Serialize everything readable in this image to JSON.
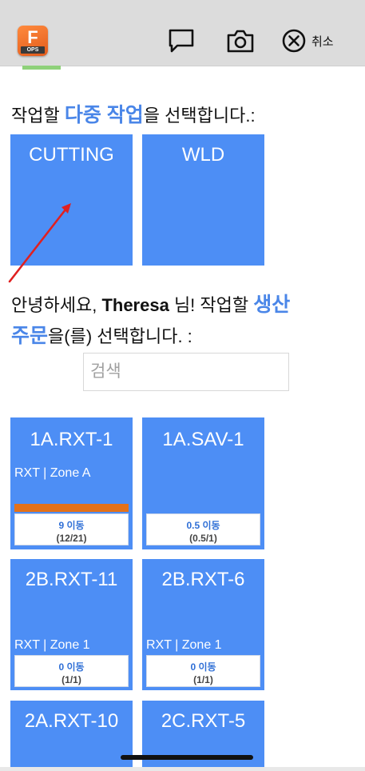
{
  "header": {
    "logo_letter": "F",
    "logo_badge": "OPS",
    "chat_icon": "chat-bubble-icon",
    "camera_icon": "camera-icon",
    "close_icon": "close-circle-icon",
    "cancel_label": "취소"
  },
  "multi_job": {
    "prompt_before": "작업할 ",
    "prompt_accent": "다중 작업",
    "prompt_after": "을 선택합니다.:",
    "tiles": [
      {
        "label": "CUTTING"
      },
      {
        "label": "WLD"
      }
    ]
  },
  "orders": {
    "greeting_before": "안녕하세요, ",
    "user_name": "Theresa",
    "greeting_mid": " 님! 작업할 ",
    "accent_1": "생산",
    "accent_2": "주문",
    "greeting_after": "을(를) 선택합니다. :",
    "search_placeholder": "검색",
    "tiles": [
      {
        "title": "1A.RXT-1",
        "subtitle": "RXT | Zone A",
        "moves": "9 이동",
        "count": "(12/21)",
        "progress": 0.57
      },
      {
        "title": "1A.SAV-1",
        "subtitle": "",
        "moves": "0.5 이동",
        "count": "(0.5/1)"
      },
      {
        "title": "2B.RXT-11",
        "subtitle": "RXT | Zone 1",
        "moves": "0 이동",
        "count": "(1/1)"
      },
      {
        "title": "2B.RXT-6",
        "subtitle": "RXT | Zone 1",
        "moves": "0 이동",
        "count": "(1/1)"
      },
      {
        "title": "2A.RXT-10"
      },
      {
        "title": "2C.RXT-5"
      }
    ]
  },
  "colors": {
    "tile_blue": "#4d8ef5",
    "accent_blue": "#4a86e8",
    "progress_orange": "#e3711a",
    "annotation_arrow": "#e02020"
  }
}
